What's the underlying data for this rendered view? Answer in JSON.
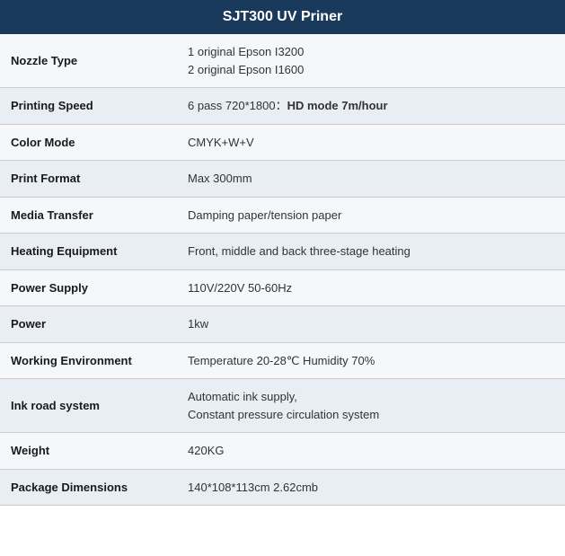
{
  "header": {
    "title": "SJT300 UV Priner"
  },
  "rows": [
    {
      "label": "Nozzle Type",
      "value": "1 original Epson I3200\n2 original Epson I1600",
      "multiline": true,
      "bold_part": null
    },
    {
      "label": "Printing Speed",
      "value": "6 pass 720*1800：",
      "value_bold": "HD mode 7m/hour",
      "multiline": false,
      "bold_part": "HD mode 7m/hour"
    },
    {
      "label": "Color Mode",
      "value": "CMYK+W+V",
      "multiline": false,
      "bold_part": null
    },
    {
      "label": "Print Format",
      "value": "Max 300mm",
      "multiline": false,
      "bold_part": null
    },
    {
      "label": "Media Transfer",
      "value": "Damping paper/tension paper",
      "multiline": false,
      "bold_part": null
    },
    {
      "label": "Heating Equipment",
      "value": "Front, middle and back three-stage heating",
      "multiline": false,
      "bold_part": null
    },
    {
      "label": "Power Supply",
      "value": "110V/220V 50-60Hz",
      "multiline": false,
      "bold_part": null
    },
    {
      "label": "Power",
      "value": "1kw",
      "multiline": false,
      "bold_part": null
    },
    {
      "label": "Working Environment",
      "value": "Temperature 20-28℃  Humidity 70%",
      "multiline": false,
      "bold_part": null
    },
    {
      "label": "Ink road system",
      "value": "Automatic ink supply,\nConstant pressure circulation system",
      "multiline": true,
      "bold_part": null
    },
    {
      "label": "Weight",
      "value": "420KG",
      "multiline": false,
      "bold_part": null
    },
    {
      "label": "Package Dimensions",
      "value": "140*108*113cm 2.62cmb",
      "multiline": false,
      "bold_part": null
    }
  ]
}
